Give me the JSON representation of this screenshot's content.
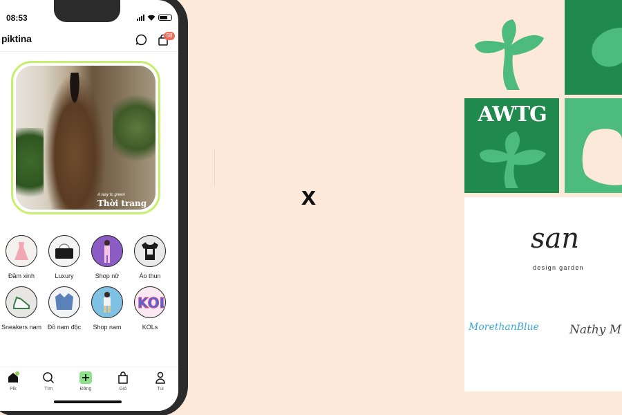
{
  "status_bar": {
    "time": "08:53"
  },
  "app": {
    "name": "piktina",
    "cart_count": "58"
  },
  "banner": {
    "tagline": "A way to green",
    "title": "Thời trang"
  },
  "categories": [
    {
      "label": "Đầm xinh"
    },
    {
      "label": "Luxury"
    },
    {
      "label": "Shop nữ"
    },
    {
      "label": "Áo thun"
    },
    {
      "label": "Sneakers nam"
    },
    {
      "label": "Đồ nam độc"
    },
    {
      "label": "Shop nam"
    },
    {
      "label": "KOLs"
    }
  ],
  "bottom_nav": [
    {
      "label": "Pik"
    },
    {
      "label": "Tìm"
    },
    {
      "label": "Đăng"
    },
    {
      "label": "Giỏ"
    },
    {
      "label": "Tui"
    }
  ],
  "collab_symbol": "x",
  "partner": {
    "logo_text": "AWTG",
    "brand": "san",
    "brand_sub": "design garden",
    "shop1": "MorethanBlue",
    "shop2": "Nathy M"
  },
  "colors": {
    "dark_green": "#1f8a4c",
    "light_green": "#4dbb7c",
    "banner_border": "#c6ef6d",
    "badge": "#ef6b5b",
    "background": "#fce9d9"
  }
}
